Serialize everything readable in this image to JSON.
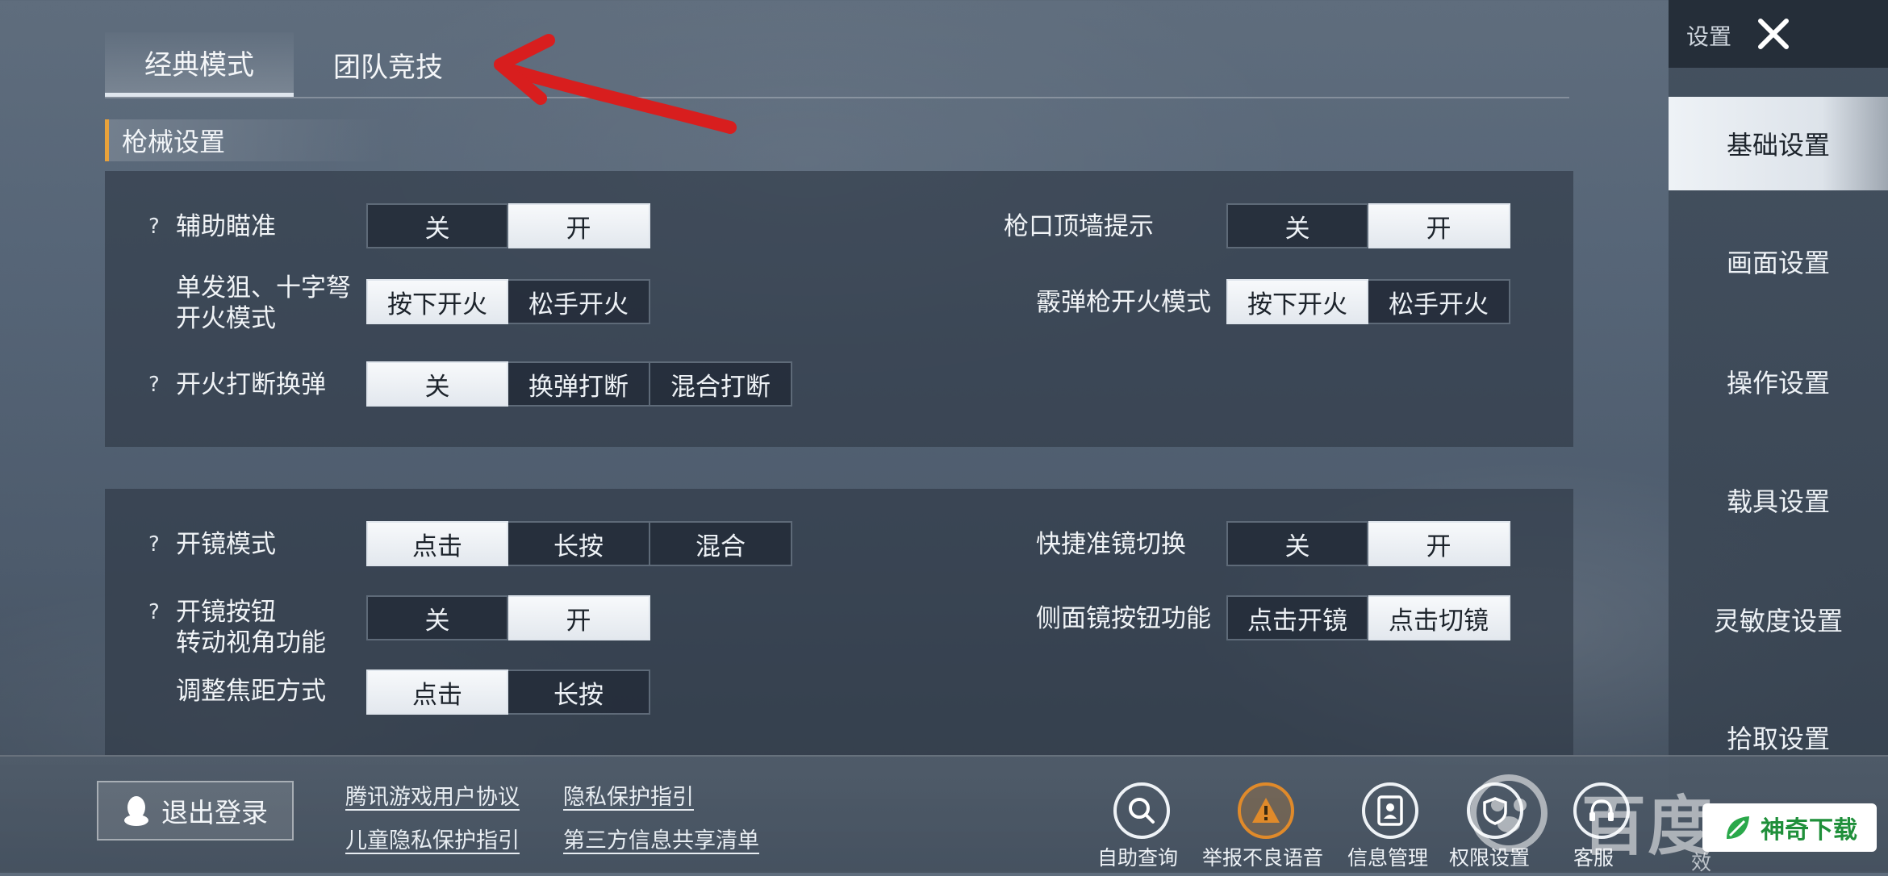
{
  "tabs": [
    "经典模式",
    "团队竞技"
  ],
  "section_title": "枪械设置",
  "panel1": {
    "assist_aim": {
      "label": "辅助瞄准",
      "options": [
        "关",
        "开"
      ],
      "selected": "开"
    },
    "muzzle_wall": {
      "label": "枪口顶墙提示",
      "options": [
        "关",
        "开"
      ],
      "selected": "开"
    },
    "single_sniper": {
      "label_line1": "单发狙、十字弩",
      "label_line2": "开火模式",
      "options": [
        "按下开火",
        "松手开火"
      ],
      "selected": "按下开火"
    },
    "shotgun": {
      "label": "霰弹枪开火模式",
      "options": [
        "按下开火",
        "松手开火"
      ],
      "selected": "按下开火"
    },
    "fire_interrupt": {
      "label": "开火打断换弹",
      "options": [
        "关",
        "换弹打断",
        "混合打断"
      ],
      "selected": "关"
    }
  },
  "panel2": {
    "scope_mode": {
      "label": "开镜模式",
      "options": [
        "点击",
        "长按",
        "混合"
      ],
      "selected": "点击"
    },
    "quick_scope": {
      "label": "快捷准镜切换",
      "options": [
        "关",
        "开"
      ],
      "selected": "开"
    },
    "scope_rotate": {
      "label_line1": "开镜按钮",
      "label_line2": "转动视角功能",
      "options": [
        "关",
        "开"
      ],
      "selected": "开"
    },
    "side_scope": {
      "label": "侧面镜按钮功能",
      "options": [
        "点击开镜",
        "点击切镜"
      ],
      "selected": "点击切镜"
    },
    "focus_adjust": {
      "label": "调整焦距方式",
      "options": [
        "点击",
        "长按"
      ],
      "selected": "点击"
    }
  },
  "help_mark": "?",
  "sidebar": {
    "title": "设置",
    "items": [
      "基础设置",
      "画面设置",
      "操作设置",
      "载具设置",
      "灵敏度设置",
      "拾取设置"
    ],
    "active": "基础设置"
  },
  "bottom": {
    "logout": "退出登录",
    "links": [
      "腾讯游戏用户协议",
      "隐私保护指引",
      "儿童隐私保护指引",
      "第三方信息共享清单"
    ],
    "buttons": [
      "自助查询",
      "举报不良语音",
      "信息管理",
      "权限设置",
      "客服"
    ],
    "cut_off_text": "效",
    "accent_color": "#e08a2a"
  },
  "watermark": {
    "text": "百度",
    "badge": "神奇下载"
  }
}
